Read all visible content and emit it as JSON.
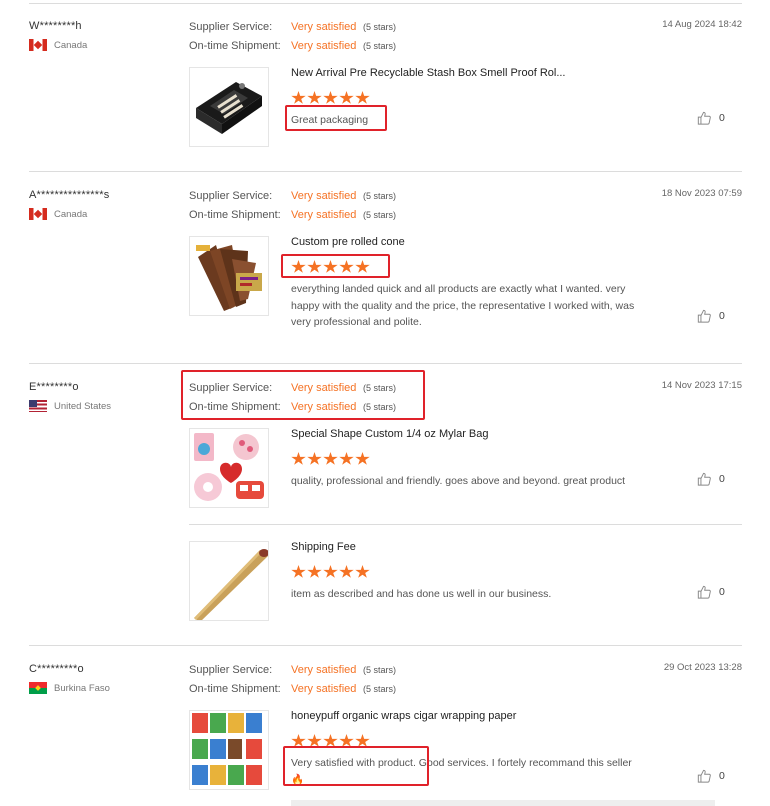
{
  "labels": {
    "supplier_service": "Supplier Service:",
    "on_time_shipment": "On-time Shipment:"
  },
  "colors": {
    "accent": "#f57224",
    "highlight": "#e0222a"
  },
  "reviews": [
    {
      "name": "W********h",
      "country": "Canada",
      "flag": "flag-ca",
      "date": "14 Aug 2024 18:42",
      "supplier_value": "Very satisfied",
      "supplier_stars": "(5 stars)",
      "shipment_value": "Very satisfied",
      "shipment_stars": "(5 stars)",
      "items": [
        {
          "title": "New Arrival Pre Recyclable Stash Box Smell Proof Rol...",
          "rating": 5,
          "comment": "Great packaging",
          "likes": "0",
          "thumb": "stash-box"
        }
      ]
    },
    {
      "name": "A***************s",
      "country": "Canada",
      "flag": "flag-ca",
      "date": "18 Nov 2023 07:59",
      "supplier_value": "Very satisfied",
      "supplier_stars": "(5 stars)",
      "shipment_value": "Very satisfied",
      "shipment_stars": "(5 stars)",
      "items": [
        {
          "title": "Custom pre rolled cone",
          "rating": 5,
          "comment": "everything landed quick and all products are exactly what I wanted. very happy with the quality and the price, the representative I worked with, was very professional and polite.",
          "likes": "0",
          "thumb": "cones"
        }
      ]
    },
    {
      "name": "E********o",
      "country": "United States",
      "flag": "flag-us",
      "date": "14 Nov 2023 17:15",
      "supplier_value": "Very satisfied",
      "supplier_stars": "(5 stars)",
      "shipment_value": "Very satisfied",
      "shipment_stars": "(5 stars)",
      "items": [
        {
          "title": "Special Shape Custom 1/4 oz Mylar Bag",
          "rating": 5,
          "comment": "quality, professional and friendly. goes above and beyond. great product",
          "likes": "0",
          "thumb": "mylar-bags"
        },
        {
          "title": "Shipping Fee",
          "rating": 5,
          "comment": "item as described and has done us well in our business.",
          "likes": "0",
          "thumb": "cone-roll"
        }
      ]
    },
    {
      "name": "C*********o",
      "country": "Burkina Faso",
      "flag": "flag-bf",
      "date": "29 Oct 2023 13:28",
      "supplier_value": "Very satisfied",
      "supplier_stars": "(5 stars)",
      "shipment_value": "Very satisfied",
      "shipment_stars": "(5 stars)",
      "items": [
        {
          "title": "honeypuff organic wraps cigar wrapping paper",
          "rating": 5,
          "comment": "Very satisfied with product. Good services. I fortely recommand this seller",
          "emoji": "🔥",
          "likes": "0",
          "thumb": "wraps"
        }
      ]
    }
  ]
}
